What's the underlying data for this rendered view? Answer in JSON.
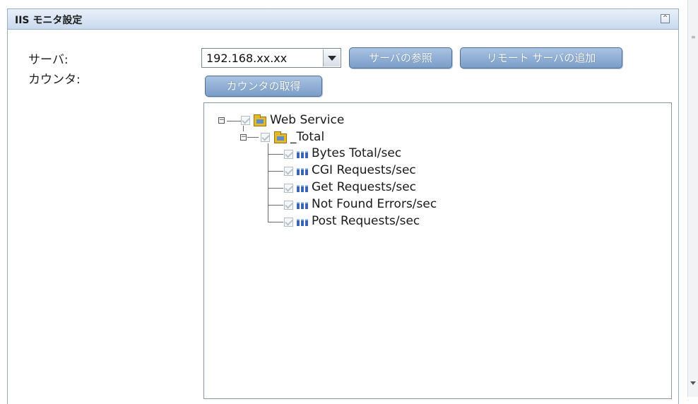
{
  "panel": {
    "title": "IIS モニタ設定",
    "collapse_icon": "collapse-icon"
  },
  "form": {
    "server_label": "サーバ:",
    "counter_label": "カウンタ:",
    "server_value": "192.168.xx.xx",
    "browse_servers_button": "サーバの参照",
    "add_remote_server_button": "リモート サーバの追加",
    "get_counters_button": "カウンタの取得"
  },
  "tree": {
    "root": {
      "label": "Web Service",
      "icon": "folder-icon",
      "checked": true
    },
    "instance": {
      "label": "_Total",
      "icon": "folder-icon",
      "checked": true
    },
    "counters": [
      {
        "label": "Bytes Total/sec",
        "icon": "counter-icon",
        "checked": true
      },
      {
        "label": "CGI Requests/sec",
        "icon": "counter-icon",
        "checked": true
      },
      {
        "label": "Get Requests/sec",
        "icon": "counter-icon",
        "checked": true
      },
      {
        "label": "Not Found Errors/sec",
        "icon": "counter-icon",
        "checked": true
      },
      {
        "label": "Post Requests/sec",
        "icon": "counter-icon",
        "checked": true
      }
    ]
  },
  "colors": {
    "header": "#c9d9ee",
    "button": "#7a9dc8",
    "border": "#9aaec8"
  }
}
